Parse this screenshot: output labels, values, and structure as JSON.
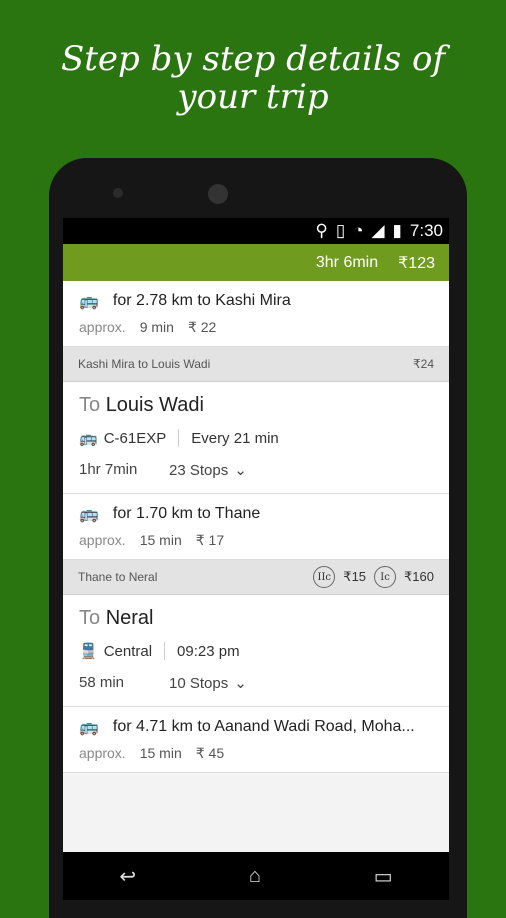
{
  "headline": {
    "line1": "Step by step details of",
    "line2": "your trip"
  },
  "status": {
    "time": "7:30"
  },
  "summary": {
    "duration": "3hr 6min",
    "fare": "₹123"
  },
  "steps": [
    {
      "type": "walk",
      "text": "for 2.78 km to Kashi Mira",
      "approx": "approx.",
      "time": "9 min",
      "fare": "₹ 22"
    },
    {
      "type": "header",
      "text": "Kashi Mira to Louis Wadi",
      "fares": [
        {
          "amount": "₹24"
        }
      ]
    },
    {
      "type": "leg",
      "to": "To",
      "destination": "Louis Wadi",
      "route": "C-61EXP",
      "frequency": "Every 21 min",
      "duration": "1hr 7min",
      "stops": "23 Stops"
    },
    {
      "type": "walk",
      "text": "for 1.70 km to Thane",
      "approx": "approx.",
      "time": "15 min",
      "fare": "₹ 17"
    },
    {
      "type": "header",
      "text": "Thane to Neral",
      "fares": [
        {
          "badge": "IIc",
          "amount": "₹15"
        },
        {
          "badge": "Ic",
          "amount": "₹160"
        }
      ]
    },
    {
      "type": "leg",
      "to": "To",
      "destination": "Neral",
      "route": "Central",
      "frequency": "09:23 pm",
      "duration": "58 min",
      "stops": "10 Stops"
    },
    {
      "type": "walk",
      "text": "for 4.71 km to Aanand Wadi Road,  Moha...",
      "approx": "approx.",
      "time": "15 min",
      "fare": "₹ 45"
    }
  ]
}
